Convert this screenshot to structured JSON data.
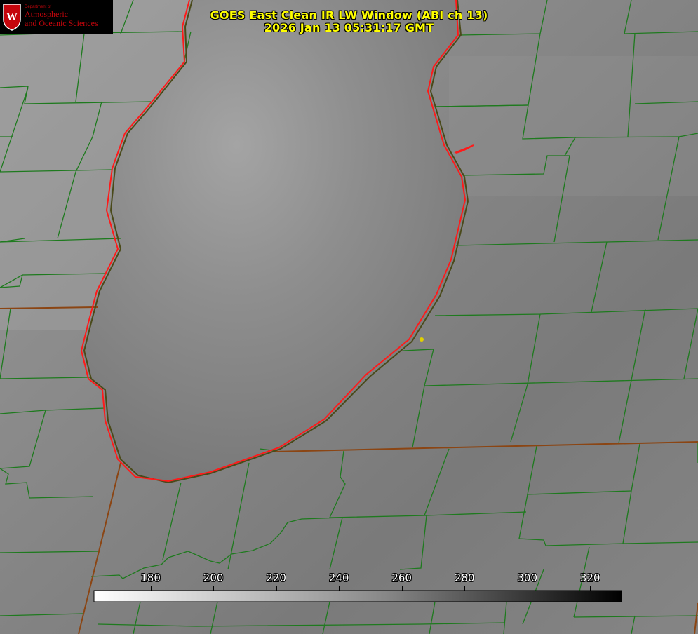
{
  "title": {
    "line1": "GOES East Clean IR LW Window (ABI ch 13)",
    "line2": "2026 Jan 13 05:31:17 GMT"
  },
  "logo": {
    "dept": "Department of",
    "line1": "Atmospheric",
    "line2": "and Oceanic Sciences",
    "crest_icon": "uw-crest-icon",
    "color": "#c5050c"
  },
  "colorbar": {
    "min": 162,
    "max": 330,
    "ticks": [
      "180",
      "200",
      "220",
      "240",
      "260",
      "280",
      "300",
      "320"
    ],
    "low_color": "#ffffff",
    "high_color": "#000000"
  },
  "colors": {
    "county_lines": "#1e7a1e",
    "state_lines": "#8b4513",
    "shoreline": "#ff1a1a",
    "station_marker": "#e0d000",
    "title": "#ffff00"
  }
}
